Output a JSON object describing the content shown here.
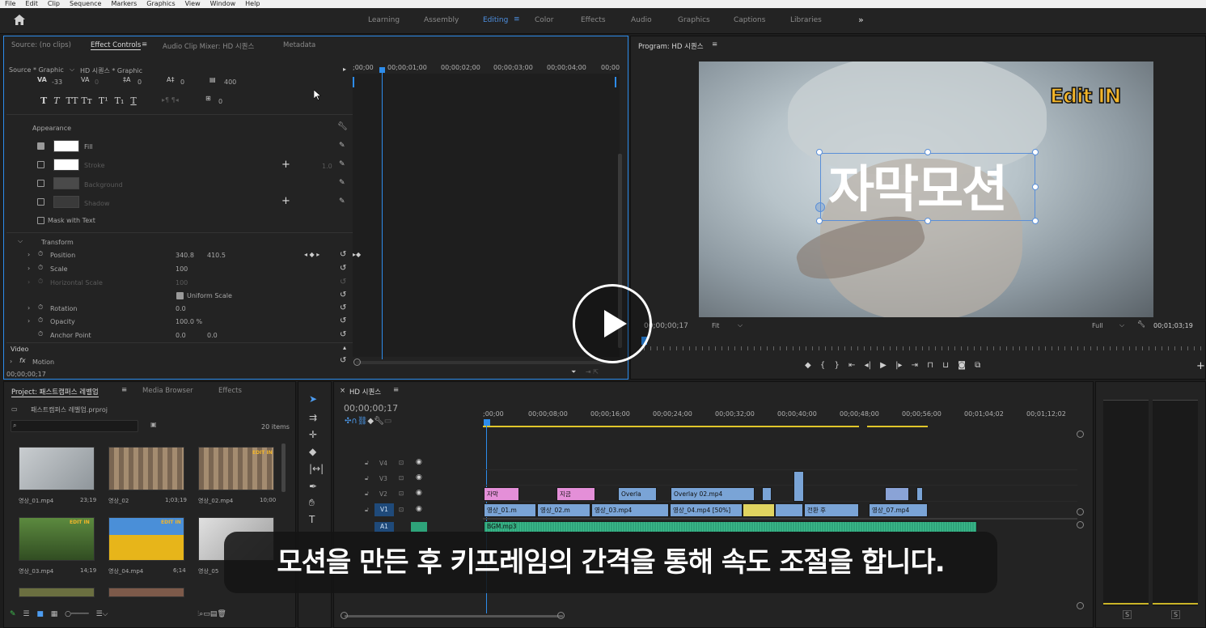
{
  "menubar": {
    "items": [
      "File",
      "Edit",
      "Clip",
      "Sequence",
      "Markers",
      "Graphics",
      "View",
      "Window",
      "Help"
    ]
  },
  "workspaces": {
    "items": [
      "Learning",
      "Assembly",
      "Editing",
      "Color",
      "Effects",
      "Audio",
      "Graphics",
      "Captions",
      "Libraries"
    ],
    "active": "Editing",
    "more": "»"
  },
  "source_panel": {
    "tabs": [
      "Source: (no clips)",
      "Effect Controls",
      "Audio Clip Mixer: HD 시퀀스",
      "Metadata"
    ],
    "source_label": "Source * Graphic",
    "sequence_label": "HD 시퀀스 * Graphic",
    "ruler": [
      ";00;00",
      "00;00;01;00",
      "00;00;02;00",
      "00;00;03;00",
      "00;00;04;00",
      "00;00"
    ],
    "text_row": {
      "tracking_val": "-33",
      "kerning_val": "0",
      "leading_val": "0",
      "baseline_val": "0",
      "tsume_val": "400",
      "indent_val": "0"
    },
    "appearance": {
      "title": "Appearance",
      "fill": "Fill",
      "stroke": "Stroke",
      "stroke_width": "1.0",
      "background": "Background",
      "shadow": "Shadow",
      "mask": "Mask with Text"
    },
    "transform": {
      "title": "Transform",
      "position_label": "Position",
      "position_x": "340.8",
      "position_y": "410.5",
      "scale_label": "Scale",
      "scale_val": "100",
      "hscale_label": "Horizontal Scale",
      "hscale_val": "100",
      "uniform": "Uniform Scale",
      "rotation_label": "Rotation",
      "rotation_val": "0.0",
      "opacity_label": "Opacity",
      "opacity_val": "100.0 %",
      "anchor_label": "Anchor Point",
      "anchor_x": "0.0",
      "anchor_y": "0.0"
    },
    "video_label": "Video",
    "motion_label": "Motion",
    "timecode": "00;00;00;17"
  },
  "program": {
    "title": "Program: HD 시퀀스",
    "overlay_logo": "Edit IN",
    "overlay_title": "자막모션",
    "timecode": "00;00;00;17",
    "fit": "Fit",
    "full": "Full",
    "duration": "00;01;03;19"
  },
  "project": {
    "tabs": [
      "Project: 패스트캠퍼스 레벨업",
      "Media Browser",
      "Effects"
    ],
    "file": "패스트캠퍼스 레벨업.prproj",
    "count": "20 items",
    "items": [
      {
        "name": "영상_01.mp4",
        "dur": "23;19"
      },
      {
        "name": "영상_02",
        "dur": "1;03;19"
      },
      {
        "name": "영상_02.mp4",
        "dur": "10;00"
      },
      {
        "name": "영상_03.mp4",
        "dur": "14;19"
      },
      {
        "name": "영상_04.mp4",
        "dur": "6;14"
      },
      {
        "name": "영상_05",
        "dur": ""
      }
    ],
    "thumb_badge": "EDIT IN"
  },
  "timeline": {
    "title": "HD 시퀀스",
    "timecode": "00;00;00;17",
    "ruler": [
      ";00;00",
      "00;00;08;00",
      "00;00;16;00",
      "00;00;24;00",
      "00;00;32;00",
      "00;00;40;00",
      "00;00;48;00",
      "00;00;56;00",
      "00;01;04;02",
      "00;01;12;02"
    ],
    "tracks": [
      "V4",
      "V3",
      "V2",
      "V1",
      "A1"
    ],
    "v2_clips": [
      "자막",
      "지금",
      "Overla",
      "Overlay 02.mp4"
    ],
    "v1_clips": [
      "영상_01.m",
      "영상_02.m",
      "영상_03.mp4",
      "영상_04.mp4 [50%]",
      "전환 후",
      "영상_07.mp4"
    ],
    "a1_clip": "BGM.mp3"
  },
  "audio_meter": {
    "solo_labels": [
      "S",
      "S"
    ]
  },
  "subtitle": "모션을 만든 후 키프레임의 간격을 통해 속도 조절을 합니다.",
  "colors": {
    "accent": "#2d8ceb",
    "clip_blue": "#7aa4d6",
    "clip_pink": "#e48fd8",
    "clip_yellow": "#e0d460",
    "audio_green": "#2ea37a"
  }
}
